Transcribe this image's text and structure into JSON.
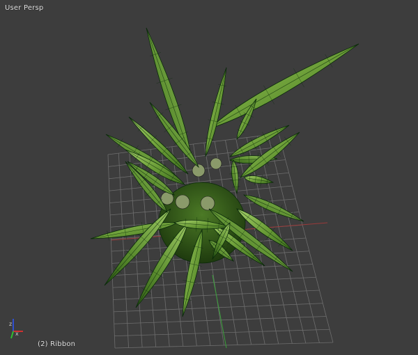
{
  "viewport": {
    "view_mode_label": "User Persp",
    "object_info": "(2) Ribbon",
    "background_color": "#3d3d3d",
    "grid_color": "#707070",
    "leaf_color": "#6ea03a",
    "wire_color": "#0a2a0a"
  },
  "axis_gizmo": {
    "x_color": "#d03030",
    "y_color": "#30c030",
    "z_color": "#3050d0",
    "icon": "axis-gizmo-icon"
  }
}
